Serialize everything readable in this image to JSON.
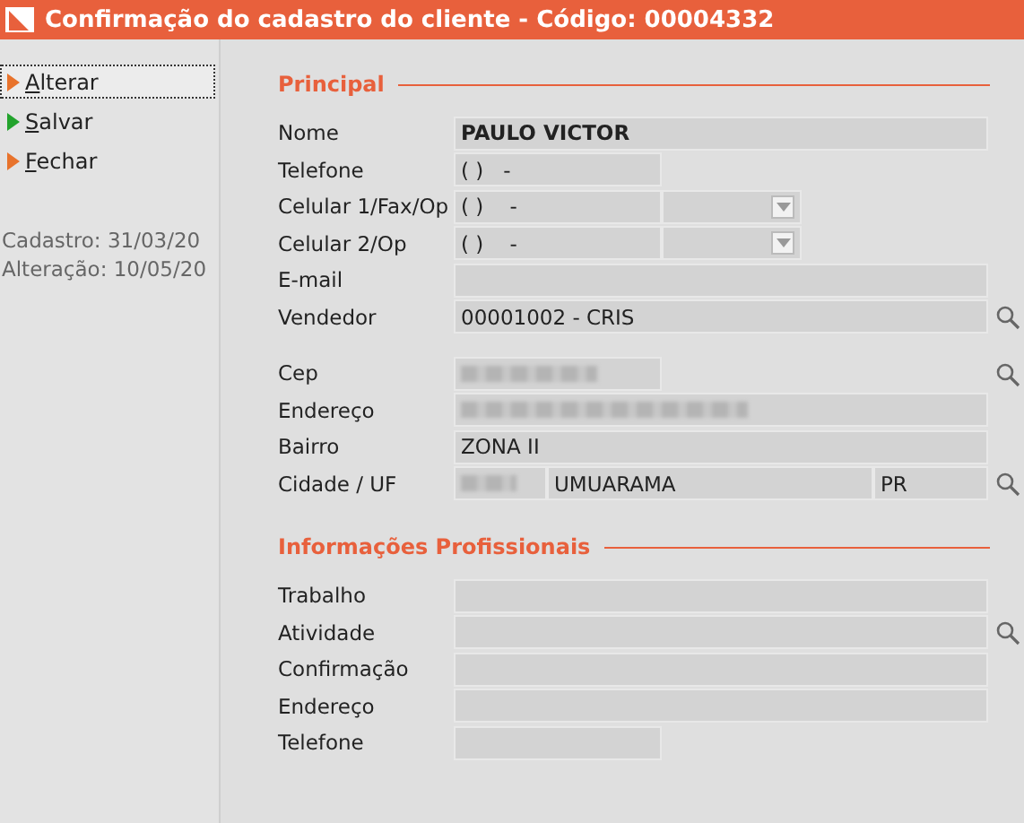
{
  "window": {
    "title": "Confirmação do cadastro do cliente - Código: 00004332"
  },
  "actions": [
    {
      "label": "Alterar",
      "color": "#e8732c",
      "focused": true
    },
    {
      "label": "Salvar",
      "color": "#22a32c",
      "focused": false
    },
    {
      "label": "Fechar",
      "color": "#e8732c",
      "focused": false
    }
  ],
  "info": [
    "Cadastro: 31/03/20",
    "Alteração: 10/05/20"
  ],
  "sections": [
    {
      "title": "Principal",
      "groups": [
        [
          {
            "label": "Nome",
            "fields": [
              {
                "kind": "wide",
                "value": "PAULO VICTOR",
                "bold": true
              }
            ],
            "search": false
          },
          {
            "label": "Telefone",
            "fields": [
              {
                "kind": "short",
                "value": "( )   -"
              }
            ],
            "search": false
          },
          {
            "label": "Celular 1/Fax/Op",
            "fields": [
              {
                "kind": "short",
                "value": "( )    -"
              },
              {
                "kind": "select"
              }
            ],
            "search": false
          },
          {
            "label": "Celular 2/Op",
            "fields": [
              {
                "kind": "short",
                "value": "( )    -"
              },
              {
                "kind": "select"
              }
            ],
            "search": false
          },
          {
            "label": "E-mail",
            "fields": [
              {
                "kind": "wide"
              }
            ],
            "search": false
          },
          {
            "label": "Vendedor",
            "fields": [
              {
                "kind": "wide",
                "value": "00001002 - CRIS"
              }
            ],
            "search": true
          }
        ],
        [
          {
            "label": "Cep",
            "fields": [
              {
                "kind": "short",
                "redacted": true
              }
            ],
            "search": true
          },
          {
            "label": "Endereço",
            "fields": [
              {
                "kind": "wide",
                "redacted": true
              }
            ],
            "search": false
          },
          {
            "label": "Bairro",
            "fields": [
              {
                "kind": "wide",
                "value": "ZONA II"
              }
            ],
            "search": false
          },
          {
            "label": "Cidade / UF",
            "fields": [
              {
                "kind": "code",
                "redacted": true
              },
              {
                "kind": "wide",
                "value": "UMUARAMA"
              },
              {
                "kind": "uf",
                "value": "PR"
              }
            ],
            "search": true
          }
        ]
      ]
    },
    {
      "title": "Informações Profissionais",
      "groups": [
        [
          {
            "label": "Trabalho",
            "fields": [
              {
                "kind": "wide"
              }
            ],
            "search": false
          },
          {
            "label": "Atividade",
            "fields": [
              {
                "kind": "wide"
              }
            ],
            "search": true
          },
          {
            "label": "Confirmação",
            "fields": [
              {
                "kind": "wide"
              }
            ],
            "search": false
          },
          {
            "label": "Endereço",
            "fields": [
              {
                "kind": "wide"
              }
            ],
            "search": false
          },
          {
            "label": "Telefone",
            "fields": [
              {
                "kind": "short"
              }
            ],
            "search": false
          }
        ]
      ]
    }
  ]
}
